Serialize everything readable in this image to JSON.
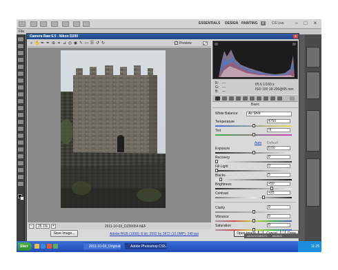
{
  "photoshop": {
    "workspaces": [
      "ESSENTIALS",
      "DESIGN",
      "PAINTING"
    ],
    "more": "»",
    "cs_live": "CS Live",
    "menu_first": "File"
  },
  "dialog": {
    "title": "Camera Raw 6.5  -  Nikon D200",
    "close": "x",
    "preview_label": "Preview",
    "preview_checked": "✓",
    "zoom": "25.1%",
    "filename": "2011-10-03_DZ00054.NEF",
    "workflow_link": "Adobe RGB (1998); 8 bit; 2592 by 3872 (10.0MP); 240 ppi",
    "buttons": {
      "save": "Save Image...",
      "open": "Open Image",
      "cancel": "Cancel",
      "done": "Done"
    }
  },
  "readout": {
    "r": "R:",
    "g": "G:",
    "b": "B:",
    "r_val": "---",
    "g_val": "---",
    "b_val": "---",
    "aperture_shutter": "f/5.6   1/160 s",
    "iso_lens": "ISO 100   18-200@65 mm"
  },
  "basic": {
    "header": "Basic",
    "white_balance_label": "White Balance:",
    "white_balance_value": "As Shot",
    "temperature_label": "Temperature",
    "temperature_value": "4750",
    "tint_label": "Tint",
    "tint_value": "-5",
    "auto": "Auto",
    "default": "Default",
    "exposure_label": "Exposure",
    "exposure_value": "0.00",
    "recovery_label": "Recovery",
    "recovery_value": "0",
    "fill_label": "Fill Light",
    "fill_value": "0",
    "blacks_label": "Blacks",
    "blacks_value": "5",
    "brightness_label": "Brightness",
    "brightness_value": "+50",
    "contrast_label": "Contrast",
    "contrast_value": "+25",
    "clarity_label": "Clarity",
    "clarity_value": "0",
    "vibrance_label": "Vibrance",
    "vibrance_value": "0",
    "saturation_label": "Saturation",
    "saturation_value": "0"
  },
  "panels": {
    "adjustments": "ADJUSTMENTS",
    "masks": "MASKS"
  },
  "taskbar": {
    "start": "Start",
    "items": [
      "2011-10-03_Originals_A",
      "Adobe Photoshop CS5..."
    ],
    "clock": "11:25"
  }
}
